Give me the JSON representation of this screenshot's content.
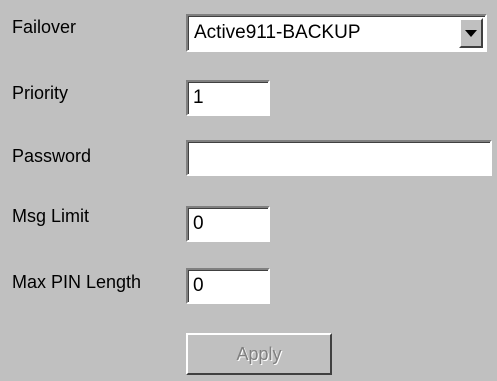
{
  "form": {
    "failover": {
      "label": "Failover",
      "selected": "Active911-BACKUP",
      "icon": "chevron-down-icon"
    },
    "priority": {
      "label": "Priority",
      "value": "1"
    },
    "password": {
      "label": "Password",
      "value": ""
    },
    "msg_limit": {
      "label": "Msg Limit",
      "value": "0"
    },
    "max_pin_length": {
      "label": "Max PIN Length",
      "value": "0"
    },
    "apply_button": {
      "label": "Apply",
      "enabled": false
    }
  },
  "colors": {
    "background": "#c0c0c0",
    "field_background": "#ffffff",
    "disabled_text": "#808080"
  }
}
